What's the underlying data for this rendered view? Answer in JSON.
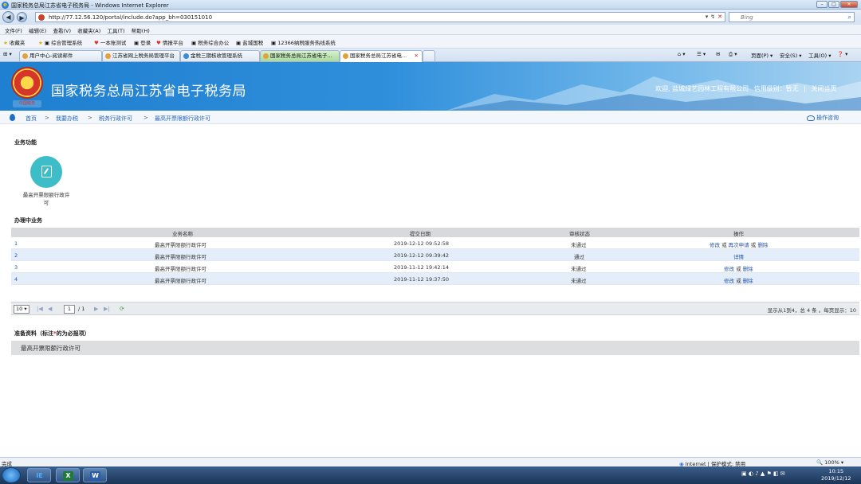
{
  "window": {
    "title": "国家税务总局江苏省电子税务局 - Windows Internet Explorer",
    "buttons": [
      "–",
      "□",
      "✕"
    ]
  },
  "address": {
    "url": "http://77.12.56.120/portal/include.do?app_bh=030151010",
    "search_placeholder": "Bing",
    "ctrls": [
      "▾",
      "↯",
      "✕"
    ]
  },
  "menu": [
    "文件(F)",
    "编辑(E)",
    "查看(V)",
    "收藏夹(A)",
    "工具(T)",
    "帮助(H)"
  ],
  "favorites": [
    "收藏夹",
    "综合管理系统",
    "一本账测试",
    "登录",
    "情报平台",
    "税务综合办公",
    "盐城国税",
    "12366纳税服务热线系统"
  ],
  "tabs": [
    "用户中心-阅读邮件",
    "江苏省网上税务局管理平台",
    "金税三期核收管理系统",
    "国家税务总局江苏省电子...",
    "国家税务总局江苏省电..."
  ],
  "commandbar": [
    "页面(P) ▾",
    "安全(S) ▾",
    "工具(O) ▾",
    "❓ ▾"
  ],
  "banner": {
    "title": "国家税务总局江苏省电子税务局",
    "emblem_text": "中国税务",
    "welcome": "欢迎, 盐城绿艺园林工程有限公司",
    "credit": "信用级别：暂无",
    "close": "关闭当页",
    "sep": "|"
  },
  "breadcrumb": {
    "items": [
      "首页",
      "我要办税",
      "税务行政许可",
      "最高开票限额行政许可"
    ],
    "sep": ">",
    "help": "操作咨询"
  },
  "functions": {
    "title": "业务功能",
    "item": "最高开票限额行政许可"
  },
  "inprogress": {
    "title": "办理中业务",
    "columns": [
      "业务名称",
      "提交日期",
      "审核状态",
      "操作"
    ],
    "rows": [
      {
        "num": "1",
        "name": "最高开票限额行政许可",
        "date": "2019-12-12 09:52:58",
        "status": "未通过",
        "ops": [
          "修改",
          "再次申请",
          "删除"
        ]
      },
      {
        "num": "2",
        "name": "最高开票限额行政许可",
        "date": "2019-12-12 09:39:42",
        "status": "通过",
        "ops": [
          "详情"
        ]
      },
      {
        "num": "3",
        "name": "最高开票限额行政许可",
        "date": "2019-11-12 19:42:14",
        "status": "未通过",
        "ops": [
          "修改",
          "删除"
        ]
      },
      {
        "num": "4",
        "name": "最高开票限额行政许可",
        "date": "2019-11-12 19:37:50",
        "status": "未通过",
        "ops": [
          "修改",
          "删除"
        ]
      }
    ],
    "or": "或"
  },
  "pager": {
    "page_size": "10",
    "page": "1",
    "of": "/ 1",
    "info": "显示从1到4，总 4 条 。每页显示：10"
  },
  "prep": {
    "title_a": "准备资料（标注",
    "star": "*",
    "title_b": "的为必报项）",
    "item": "最高开票限额行政许可"
  },
  "status": {
    "left": "完成",
    "zone": "Internet | 保护模式: 禁用",
    "zoom": "100%"
  },
  "clock": {
    "time": "10:15",
    "date": "2019/12/12"
  },
  "taskbar_apps": [
    "IE",
    "X",
    "W"
  ]
}
